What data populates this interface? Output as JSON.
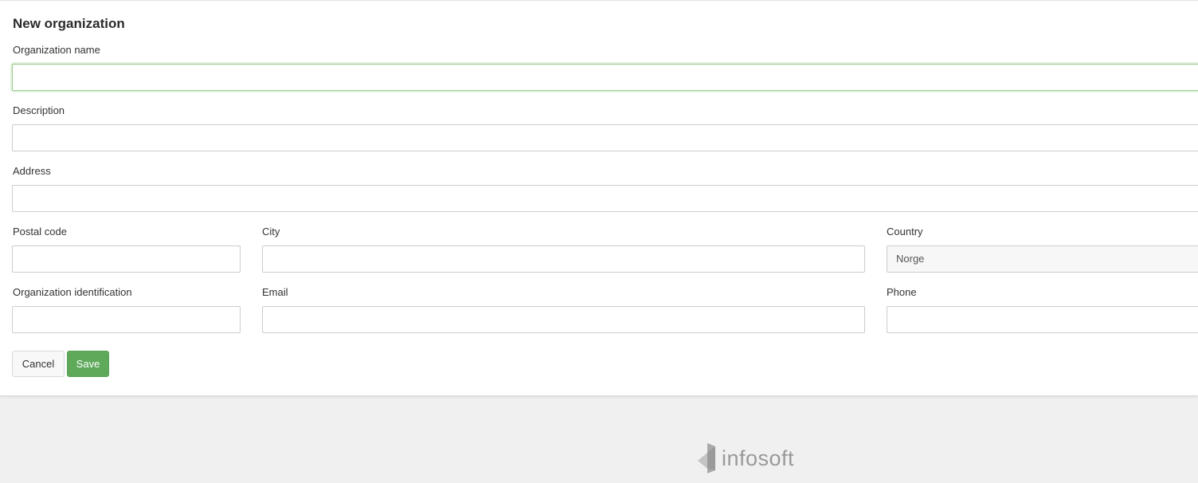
{
  "form": {
    "title": "New organization",
    "fields": {
      "organization_name": {
        "label": "Organization name",
        "value": "",
        "placeholder": ""
      },
      "description": {
        "label": "Description",
        "value": "",
        "placeholder": ""
      },
      "address": {
        "label": "Address",
        "value": "",
        "placeholder": ""
      },
      "postal_code": {
        "label": "Postal code",
        "value": "",
        "placeholder": ""
      },
      "city": {
        "label": "City",
        "value": "",
        "placeholder": ""
      },
      "country": {
        "label": "Country",
        "value": "Norge"
      },
      "organization_identification": {
        "label": "Organization identification",
        "value": "",
        "placeholder": ""
      },
      "email": {
        "label": "Email",
        "value": "",
        "placeholder": ""
      },
      "phone": {
        "label": "Phone",
        "value": "",
        "placeholder": ""
      }
    },
    "buttons": {
      "cancel": "Cancel",
      "save": "Save"
    }
  },
  "footer": {
    "logo_text": "infosoft",
    "logo_icon": "infosoft-logo-icon"
  },
  "colors": {
    "save_button": "#5fa95b",
    "focus_border": "#9ccc8f",
    "page_background": "#f0f0f0",
    "logo_gray": "#999999"
  }
}
